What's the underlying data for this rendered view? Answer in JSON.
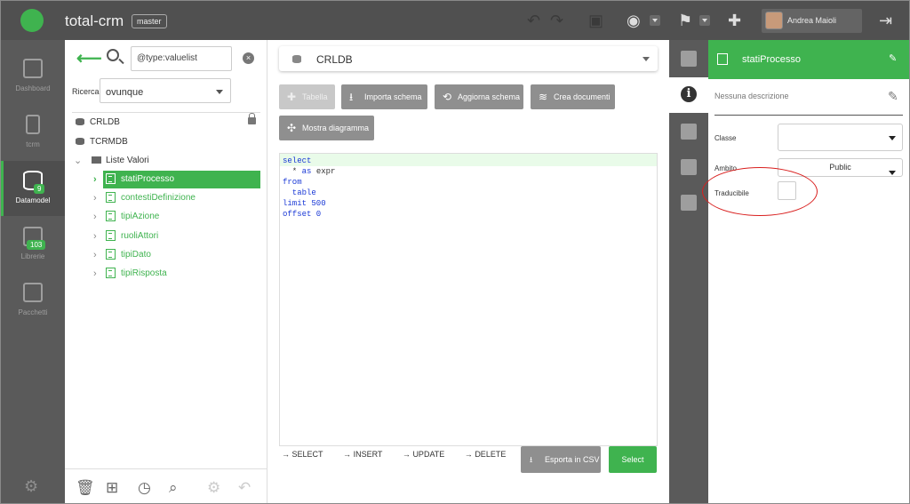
{
  "topbar": {
    "app_name": "total-crm",
    "branch": "master",
    "user_name": "Andrea Maioli",
    "icons": [
      "undo-icon",
      "redo-icon",
      "save-icon",
      "eye-icon",
      "signpost-icon",
      "add-user-icon",
      "logout-icon"
    ]
  },
  "leftnav": {
    "items": [
      {
        "label": "Dashboard",
        "icon": "dashboard-icon",
        "active": false
      },
      {
        "label": "tcrm",
        "icon": "phone-icon",
        "active": false
      },
      {
        "label": "Datamodel",
        "icon": "database-icon",
        "badge": "9",
        "active": true
      },
      {
        "label": "Librerie",
        "icon": "library-icon",
        "badge": "103",
        "active": false
      },
      {
        "label": "Pacchetti",
        "icon": "package-icon",
        "active": false
      }
    ]
  },
  "tree": {
    "search_value": "@type:valuelist",
    "ricerca_label": "Ricerca",
    "ricerca_value": "ovunque",
    "nodes": {
      "crldb": "CRLDB",
      "tcrmdb": "TCRMDB",
      "liste_valori": "Liste Valori",
      "items": [
        "statiProcesso",
        "contestiDefinizione",
        "tipiAzione",
        "ruoliAttori",
        "tipiDato",
        "tipiRisposta"
      ]
    }
  },
  "main": {
    "db_name": "CRLDB",
    "toolbar": {
      "tabella": "Tabella",
      "importa": "Importa schema",
      "aggiorna": "Aggiorna schema",
      "crea": "Crea documenti",
      "diagramma": "Mostra diagramma"
    },
    "sql": {
      "l1": "select",
      "l2a": "  * ",
      "l2b": "as",
      "l2c": " expr",
      "l3": "from",
      "l4": "  table",
      "l5": "limit 500",
      "l6": "offset 0"
    },
    "ops": [
      "SELECT",
      "INSERT",
      "UPDATE",
      "DELETE"
    ],
    "csv_button": "Esporta in CSV",
    "select_button": "Select"
  },
  "props": {
    "title": "statiProcesso",
    "description": "Nessuna descrizione",
    "classe_label": "Classe",
    "classe_value": "",
    "ambito_label": "Ambito",
    "ambito_value": "Public",
    "traducibile_label": "Traducibile"
  },
  "colors": {
    "accent": "#3fb34f",
    "annotation": "#d9201f"
  }
}
